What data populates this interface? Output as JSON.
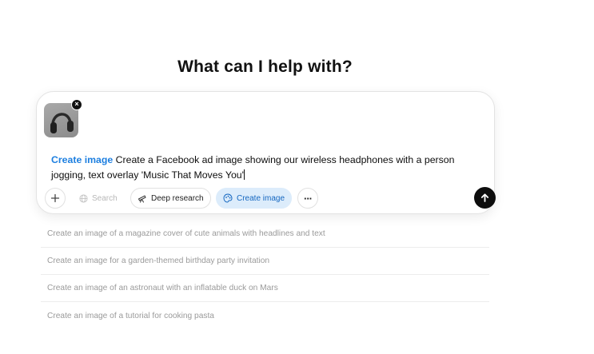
{
  "heading": "What can I help with?",
  "composer": {
    "attachment": {
      "icon": "headphones-thumbnail",
      "remove_icon": "close-icon",
      "remove_label": "×"
    },
    "tool_tag": "Create image",
    "prompt": " Create a Facebook ad image showing our wireless headphones with a person jogging, text overlay 'Music That Moves You'",
    "toolbar": {
      "add_icon": "plus-icon",
      "search_label": "Search",
      "search_icon": "globe-icon",
      "deep_research_label": "Deep research",
      "deep_research_icon": "telescope-icon",
      "create_image_label": "Create image",
      "create_image_icon": "palette-icon",
      "more_icon": "ellipsis-icon",
      "more_label": "···",
      "send_icon": "arrow-up-icon"
    },
    "colors": {
      "accent": "#1d7fe0",
      "active_bg": "#dcecfb",
      "send_bg": "#0d0d0d"
    }
  },
  "suggestions": [
    "Create an image of a magazine cover of cute animals with headlines and text",
    "Create an image for a garden-themed birthday party invitation",
    "Create an image of an astronaut with an inflatable duck on Mars",
    "Create an image of a tutorial for cooking pasta"
  ]
}
